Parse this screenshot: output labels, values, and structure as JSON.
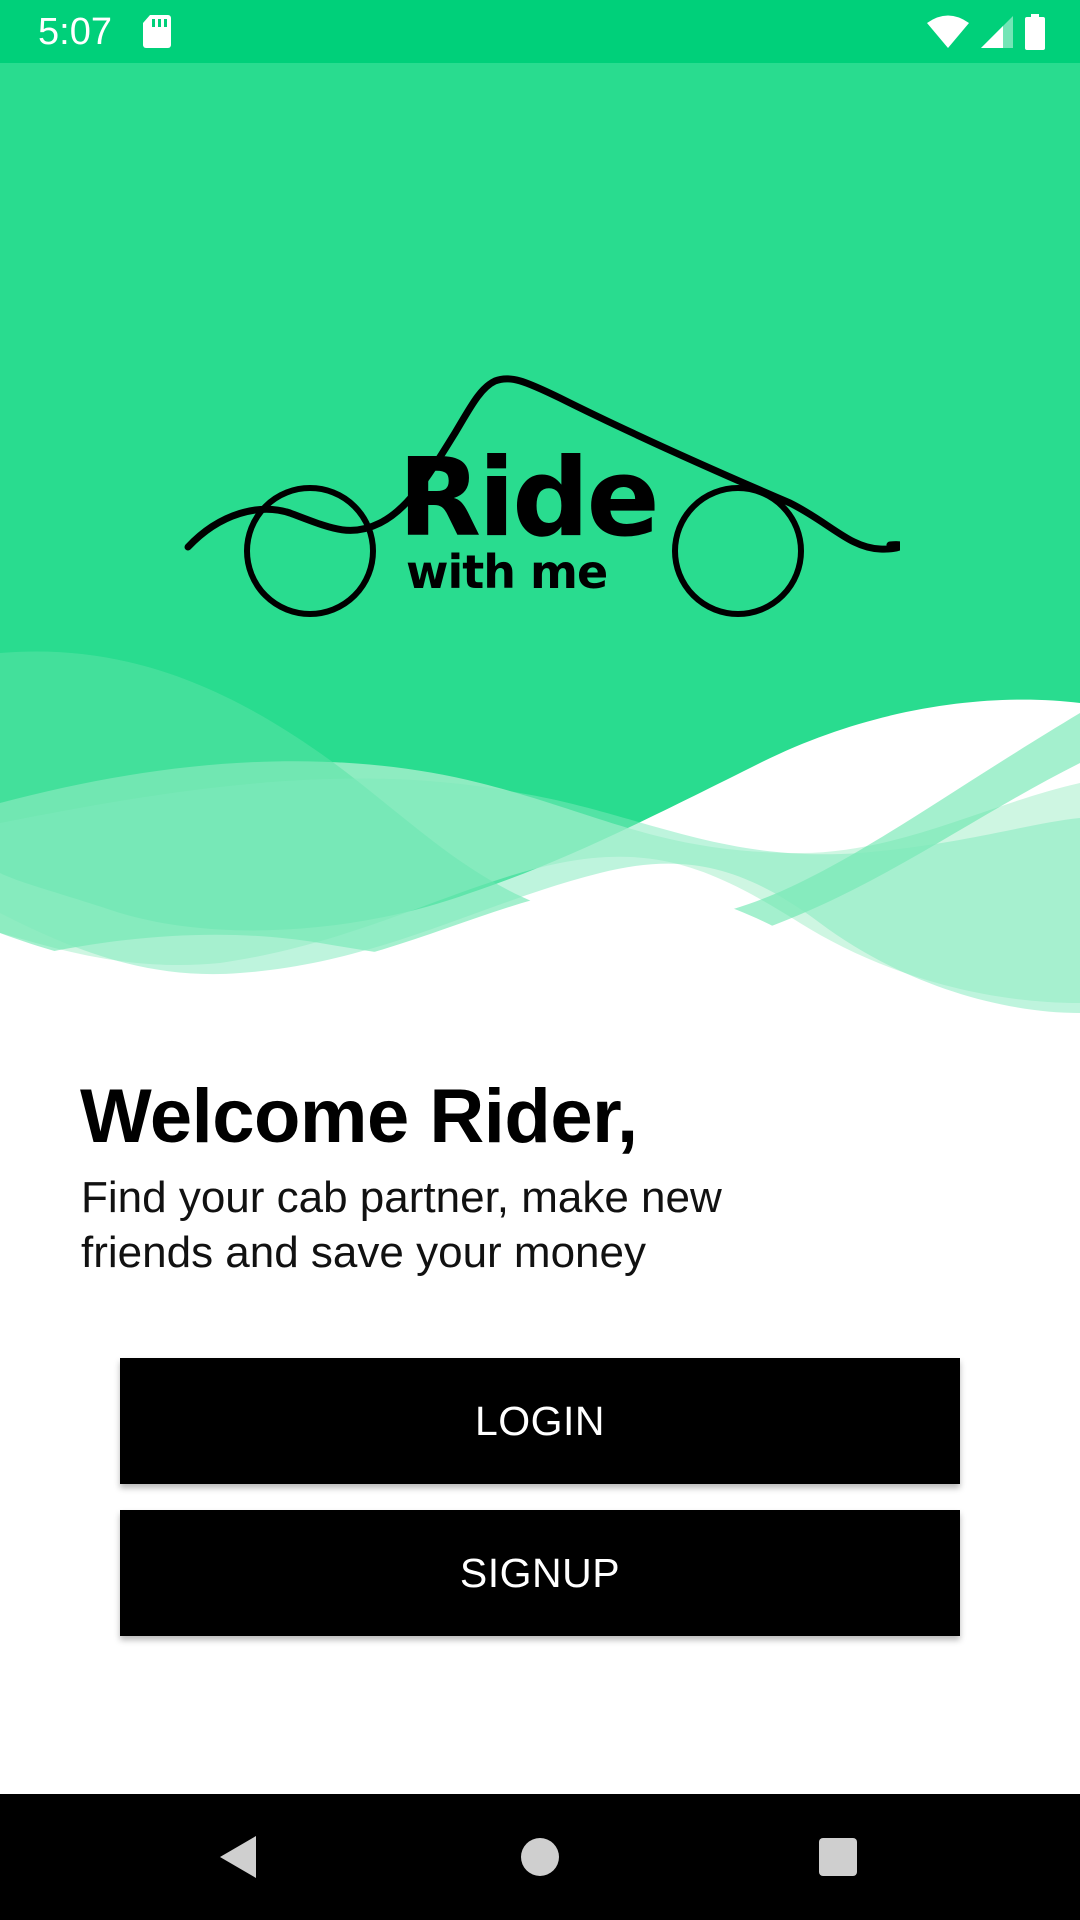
{
  "status_bar": {
    "time": "5:07",
    "icons": [
      "sd-card-icon",
      "wifi-icon",
      "cell-signal-icon",
      "battery-icon"
    ],
    "background": "#00d07a"
  },
  "hero": {
    "background": "#29dc8f",
    "logo": {
      "brand_name": "Ride",
      "brand_tagline": "with me"
    }
  },
  "welcome": {
    "title": "Welcome Rider,",
    "subtitle_line1": "Find your cab partner, make new",
    "subtitle_line2": "friends and save your money"
  },
  "actions": {
    "login_label": "LOGIN",
    "signup_label": "SIGNUP",
    "button_color": "#000000"
  },
  "nav_bar": {
    "icons": [
      "back-icon",
      "home-icon",
      "recents-icon"
    ]
  }
}
